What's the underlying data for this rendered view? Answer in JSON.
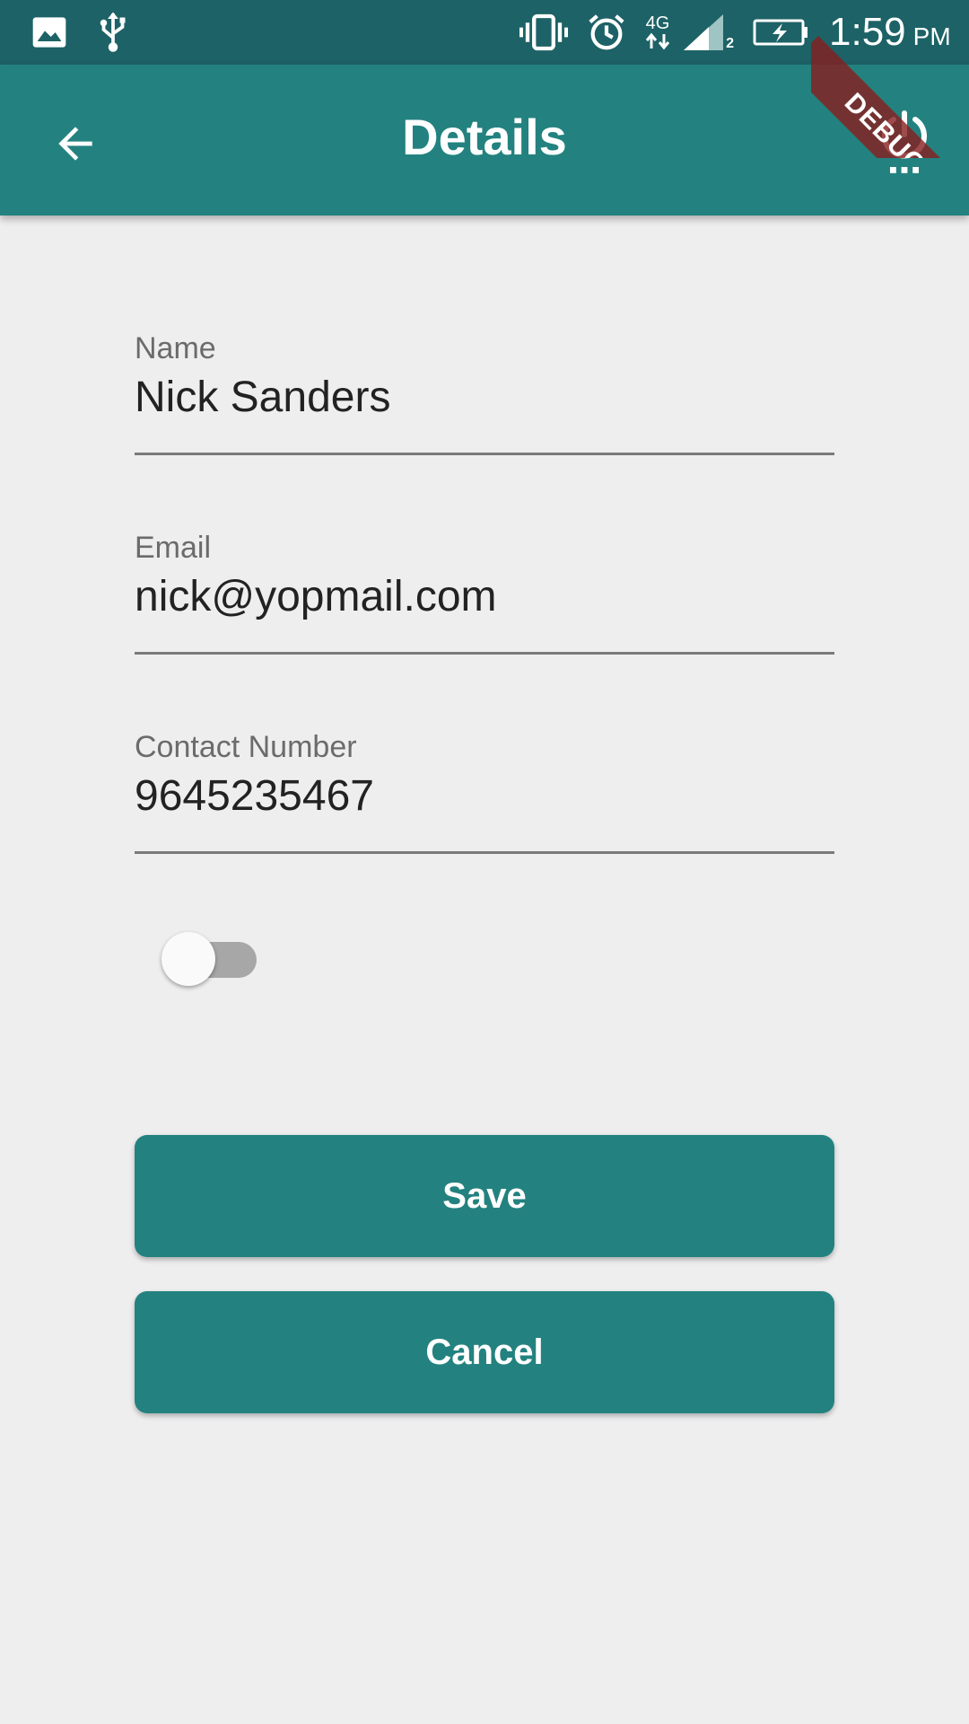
{
  "status_bar": {
    "time": "1:59",
    "ampm": "PM",
    "network_type": "4G",
    "sim_slot": "2",
    "icons": [
      "image-icon",
      "usb-icon",
      "vibrate-icon",
      "alarm-icon",
      "network-4g-icon",
      "signal-icon",
      "battery-charging-icon"
    ]
  },
  "app_bar": {
    "title": "Details",
    "back_icon": "arrow-back-icon",
    "power_icon": "power-settings-icon"
  },
  "debug_banner": "DEBUG",
  "form": {
    "name": {
      "label": "Name",
      "value": "Nick Sanders"
    },
    "email": {
      "label": "Email",
      "value": "nick@yopmail.com"
    },
    "contact": {
      "label": "Contact Number",
      "value": "9645235467"
    },
    "toggle": {
      "state": "off"
    }
  },
  "buttons": {
    "save": "Save",
    "cancel": "Cancel"
  },
  "colors": {
    "primary": "#23827f",
    "status_bar": "#1d6266",
    "background": "#eeeeef",
    "debug_ribbon": "#871e1e"
  }
}
